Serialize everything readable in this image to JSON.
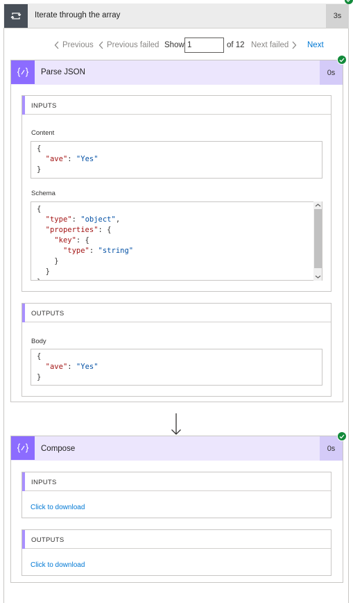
{
  "loop": {
    "title": "Iterate through the array",
    "duration": "3s",
    "icon": "loop-icon"
  },
  "pager": {
    "previous": "Previous",
    "previous_failed": "Previous failed",
    "show": "Show",
    "current": "1",
    "of": "of 12",
    "next_failed": "Next failed",
    "next": "Next"
  },
  "parse_json": {
    "title": "Parse JSON",
    "duration": "0s",
    "icon": "data-operation-icon",
    "status": "succeeded",
    "inputs_label": "INPUTS",
    "content_label": "Content",
    "content_lines": [
      [
        {
          "t": "p",
          "v": "{"
        }
      ],
      [
        {
          "t": "p",
          "v": "  "
        },
        {
          "t": "key",
          "v": "\"ave\""
        },
        {
          "t": "p",
          "v": ": "
        },
        {
          "t": "str",
          "v": "\"Yes\""
        }
      ],
      [
        {
          "t": "p",
          "v": "}"
        }
      ]
    ],
    "schema_label": "Schema",
    "schema_lines": [
      [
        {
          "t": "p",
          "v": "{"
        }
      ],
      [
        {
          "t": "p",
          "v": "  "
        },
        {
          "t": "key",
          "v": "\"type\""
        },
        {
          "t": "p",
          "v": ": "
        },
        {
          "t": "str",
          "v": "\"object\""
        },
        {
          "t": "p",
          "v": ","
        }
      ],
      [
        {
          "t": "p",
          "v": "  "
        },
        {
          "t": "key",
          "v": "\"properties\""
        },
        {
          "t": "p",
          "v": ": {"
        }
      ],
      [
        {
          "t": "p",
          "v": "    "
        },
        {
          "t": "key",
          "v": "\"key\""
        },
        {
          "t": "p",
          "v": ": {"
        }
      ],
      [
        {
          "t": "p",
          "v": "      "
        },
        {
          "t": "key",
          "v": "\"type\""
        },
        {
          "t": "p",
          "v": ": "
        },
        {
          "t": "str",
          "v": "\"string\""
        }
      ],
      [
        {
          "t": "p",
          "v": "    }"
        }
      ],
      [
        {
          "t": "p",
          "v": "  }"
        }
      ],
      [
        {
          "t": "p",
          "v": "}"
        }
      ]
    ],
    "outputs_label": "OUTPUTS",
    "body_label": "Body",
    "body_lines": [
      [
        {
          "t": "p",
          "v": "{"
        }
      ],
      [
        {
          "t": "p",
          "v": "  "
        },
        {
          "t": "key",
          "v": "\"ave\""
        },
        {
          "t": "p",
          "v": ": "
        },
        {
          "t": "str",
          "v": "\"Yes\""
        }
      ],
      [
        {
          "t": "p",
          "v": "}"
        }
      ]
    ]
  },
  "compose": {
    "title": "Compose",
    "duration": "0s",
    "icon": "data-operation-icon",
    "status": "succeeded",
    "inputs_label": "INPUTS",
    "inputs_link": "Click to download",
    "outputs_label": "OUTPUTS",
    "outputs_link": "Click to download"
  },
  "colors": {
    "action_accent": "#8c6cff",
    "action_header_bg": "#ece6fd",
    "success": "#128a3a",
    "link": "#0078d4",
    "json_key": "#a31515",
    "json_string": "#0451a5"
  }
}
